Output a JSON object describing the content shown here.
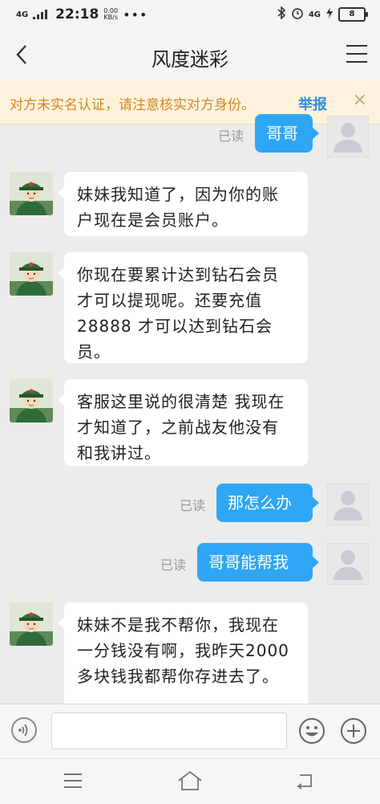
{
  "status_bar": {
    "network": "4G",
    "time": "22:18",
    "speed": "0.00",
    "speed_unit": "KB/s",
    "dots": "•••",
    "right_network": "4G",
    "battery": "8"
  },
  "header": {
    "title": "风度迷彩"
  },
  "warning": {
    "text": "对方未实名认证，请注意核实对方身份。",
    "action": "举报",
    "close": "×"
  },
  "messages": [
    {
      "from": "me",
      "text": "哥哥",
      "status": "已读"
    },
    {
      "from": "other",
      "text": "妹妹我知道了，因为你的账户现在是会员账户。"
    },
    {
      "from": "other",
      "text": "你现在要累计达到钻石会员才可以提现呢。还要充值28888 才可以达到钻石会员。"
    },
    {
      "from": "other",
      "text": "客服这里说的很清楚 我现在才知道了，之前战友他没有和我讲过。"
    },
    {
      "from": "me",
      "text": "那怎么办",
      "status": "已读"
    },
    {
      "from": "me",
      "text": "哥哥能帮我",
      "status": "已读"
    },
    {
      "from": "other",
      "text": "妹妹不是我不帮你，我现在一分钱没有啊，我昨天2000多块钱我都帮你存进去了。"
    }
  ],
  "input": {
    "value": ""
  },
  "colors": {
    "outgoing_bubble": "#2ea6f3",
    "warning_text": "#d4862a",
    "report_link": "#2f8ee5",
    "warning_bg": "#fdf3dc"
  }
}
